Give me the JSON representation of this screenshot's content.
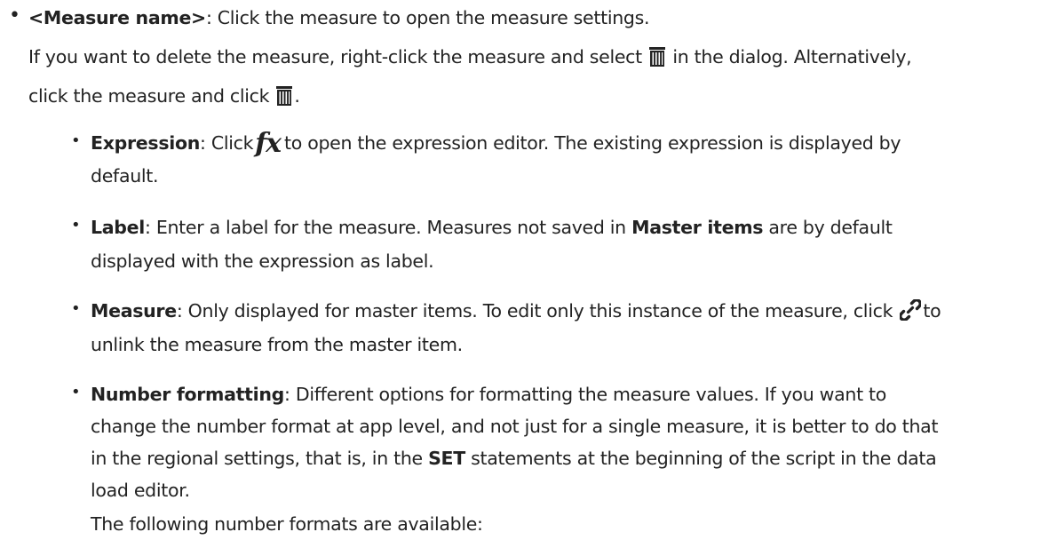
{
  "measure_name": {
    "term": "<Measure name>",
    "desc": ": Click the measure to open the measure settings.",
    "line2_a": "If you want to delete the measure, right-click the measure and select",
    "line2_b": "in the dialog. Alternatively,",
    "line3_a": "click the measure and click",
    "line3_b": "."
  },
  "expression": {
    "term": "Expression",
    "desc_a": ": Click",
    "fx_symbol": "fx",
    "desc_b": "to open the expression editor. The existing expression is displayed by",
    "line2": "default."
  },
  "label": {
    "term": "Label",
    "desc_a": ": Enter a label for the measure. Measures not saved in",
    "master_items": "Master items",
    "desc_b": "are by default",
    "line2": "displayed with the expression as label."
  },
  "measure": {
    "term": "Measure",
    "desc_a": ": Only displayed for master items. To edit only this instance of the measure, click",
    "desc_b": "to",
    "line2": "unlink the measure from the master item."
  },
  "number_formatting": {
    "term": "Number formatting",
    "desc": ": Different options for formatting the measure values. If you want to",
    "line2": "change the number format at app level, and not just for a single measure, it is better to do that",
    "line3_a": "in the regional settings, that is, in the",
    "set": "SET",
    "line3_b": "statements at the beginning of the script in the data",
    "line4": "load editor."
  },
  "formats_intro": "The following number formats are available:",
  "icons": {
    "delete": "trash-icon",
    "expression": "fx-icon",
    "unlink": "unlink-chain-icon"
  }
}
